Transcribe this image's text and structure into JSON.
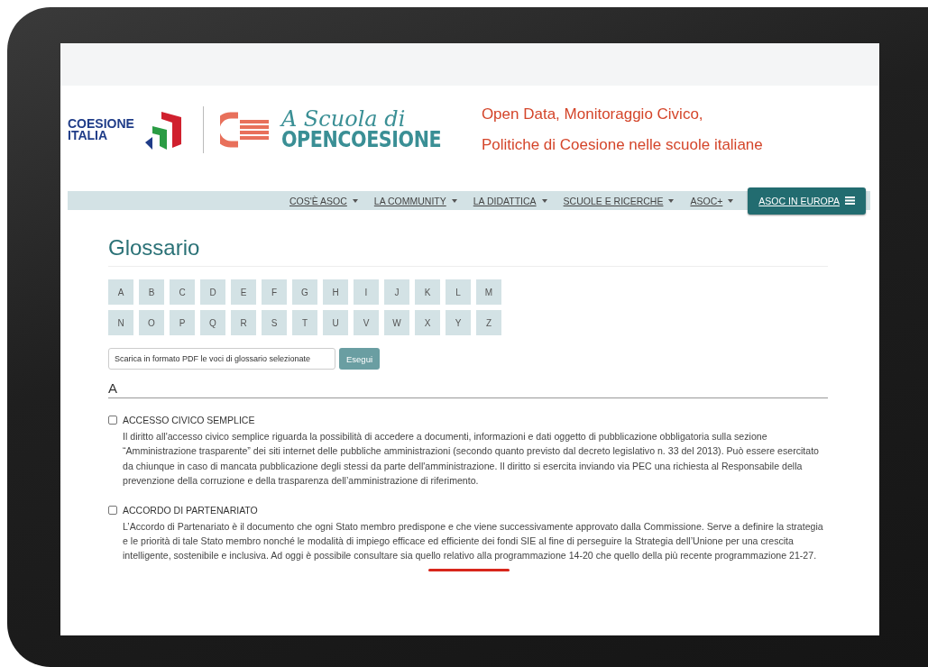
{
  "header": {
    "brand_left": [
      "COESIONE",
      "ITALIA"
    ],
    "brand_script": "A Scuola di",
    "brand_main": "OPENCOESIONE",
    "tagline": [
      "Open Data, Monitoraggio Civico,",
      "Politiche di Coesione nelle scuole italiane"
    ]
  },
  "nav": [
    {
      "label": "COS'È ASOC",
      "dropdown": true,
      "selected": false
    },
    {
      "label": "LA COMMUNITY",
      "dropdown": true,
      "selected": false
    },
    {
      "label": "LA DIDATTICA",
      "dropdown": true,
      "selected": false
    },
    {
      "label": "SCUOLE E RICERCHE",
      "dropdown": true,
      "selected": false
    },
    {
      "label": "ASOC+",
      "dropdown": true,
      "selected": false
    },
    {
      "label": "ASOC IN EUROPA",
      "dropdown": false,
      "selected": true
    }
  ],
  "page_title": "Glossario",
  "letters": [
    [
      "A",
      "B",
      "C",
      "D",
      "E",
      "F",
      "G",
      "H",
      "I",
      "J",
      "K",
      "L",
      "M"
    ],
    [
      "N",
      "O",
      "P",
      "Q",
      "R",
      "S",
      "T",
      "U",
      "V",
      "W",
      "X",
      "Y",
      "Z"
    ]
  ],
  "download": {
    "placeholder": "Scarica in formato PDF le voci di glossario selezionate",
    "button": "Esegui"
  },
  "section": "A",
  "entries": [
    {
      "term": "ACCESSO CIVICO SEMPLICE",
      "checked": false,
      "definition": "Il diritto all'accesso civico semplice riguarda la possibilità di accedere a documenti, informazioni e dati oggetto di pubblicazione obbligatoria sulla sezione “Amministrazione trasparente” dei siti internet delle pubbliche amministrazioni (secondo quanto previsto dal decreto legislativo n. 33 del 2013). Può essere esercitato da chiunque in caso di mancata pubblicazione degli stessi da parte dell'amministrazione. Il diritto si esercita inviando via PEC una richiesta al Responsabile della prevenzione della corruzione e della trasparenza dell’amministrazione di riferimento."
    },
    {
      "term": "ACCORDO DI PARTENARIATO",
      "checked": false,
      "definition": "L’Accordo di Partenariato è il documento che ogni Stato membro predispone e che viene successivamente approvato dalla Commissione. Serve a definire la strategia e le priorità di tale Stato membro nonché le modalità di impiego efficace ed efficiente dei fondi SIE al fine di perseguire la Strategia dell’Unione per una crescita intelligente, sostenibile e inclusiva. Ad oggi è possibile consultare sia quello relativo alla programmazione 14-20 che quello della più recente programmazione 21-27."
    }
  ]
}
